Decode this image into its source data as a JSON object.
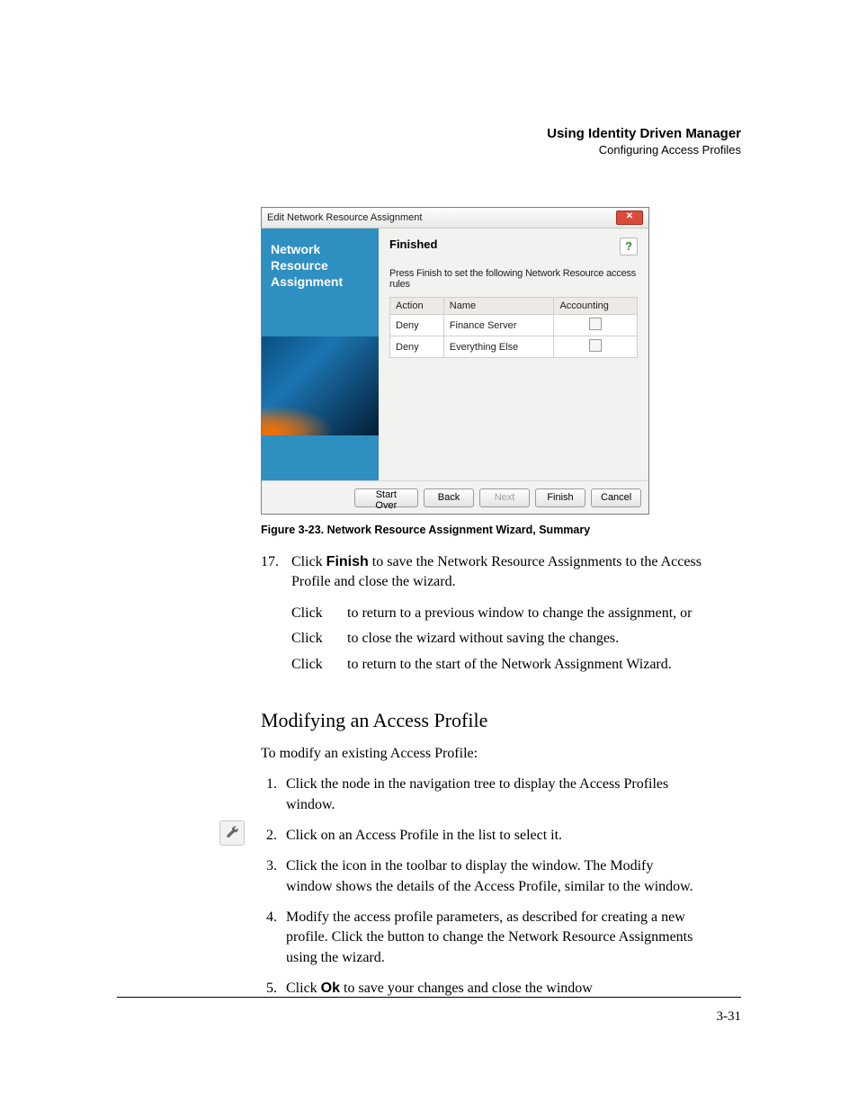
{
  "header": {
    "title": "Using Identity Driven Manager",
    "subtitle": "Configuring Access Profiles"
  },
  "dialog": {
    "title": "Edit Network Resource Assignment",
    "close_glyph": "✕",
    "sidebar_lines": [
      "Network",
      "Resource",
      "Assignment"
    ],
    "main_title": "Finished",
    "help_glyph": "?",
    "description": "Press Finish to set the following Network Resource access rules",
    "columns": [
      "Action",
      "Name",
      "Accounting"
    ],
    "rows": [
      {
        "action": "Deny",
        "name": "Finance Server",
        "accounting": false
      },
      {
        "action": "Deny",
        "name": "Everything Else",
        "accounting": false
      }
    ],
    "buttons": {
      "start_over": "Start Over",
      "back": "Back",
      "next": "Next",
      "finish": "Finish",
      "cancel": "Cancel"
    }
  },
  "figure_caption": "Figure 3-23. Network Resource Assignment Wizard, Summary",
  "step17": {
    "num": "17.",
    "prefix": "Click ",
    "bold": "Finish",
    "rest": " to save the Network Resource Assignments to the Access Profile and close the wizard."
  },
  "click_rows": [
    {
      "c1": "Click",
      "c2": "to return to a previous window to change the assignment, or"
    },
    {
      "c1": "Click",
      "c2": "to close the wizard without saving the changes."
    },
    {
      "c1": "Click",
      "c2": "to return to the start of the Network Assignment Wizard."
    }
  ],
  "section_heading": "Modifying an Access Profile",
  "section_intro": "To modify an existing Access Profile:",
  "steps": [
    "Click the                       node in the navigation tree to display the Access Profiles window.",
    "Click on an Access Profile in the list to select it.",
    "Click the                               icon in the toolbar to display the               window. The Modify window shows the details of the Access Profile, similar to the                                  window.",
    "Modify the access profile parameters, as described for creating a new profile. Click the           button to change the Network Resource Assignments using the wizard."
  ],
  "step5": {
    "prefix": "Click ",
    "bold": "Ok",
    "rest": " to save your changes and close the window"
  },
  "page_number": "3-31"
}
